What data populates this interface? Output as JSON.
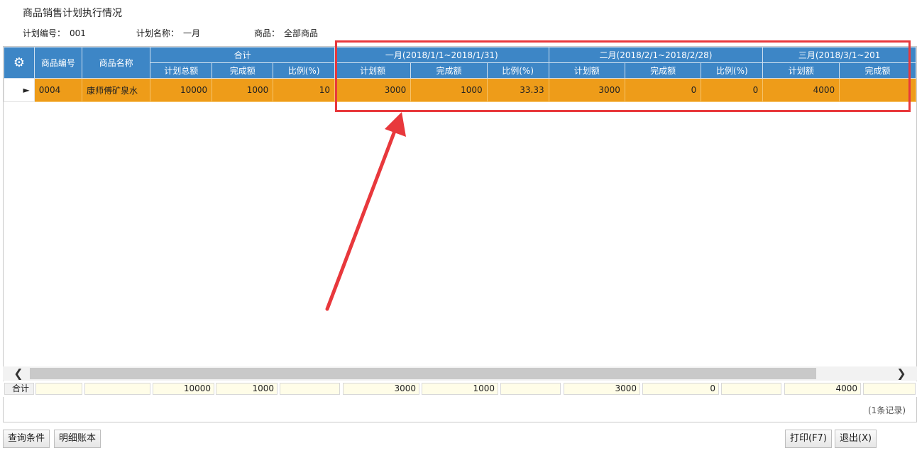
{
  "page_title": "商品销售计划执行情况",
  "meta": {
    "plan_no_label": "计划编号：",
    "plan_no": "001",
    "plan_name_label": "计划名称：",
    "plan_name": "一月",
    "goods_label": "商品：",
    "goods": "全部商品"
  },
  "grid": {
    "col_code": "商品编号",
    "col_name": "商品名称",
    "groups": [
      {
        "label": "合计",
        "sub": [
          "计划总额",
          "完成额",
          "比例(%)"
        ]
      },
      {
        "label": "一月(2018/1/1~2018/1/31)",
        "sub": [
          "计划额",
          "完成额",
          "比例(%)"
        ]
      },
      {
        "label": "二月(2018/2/1~2018/2/28)",
        "sub": [
          "计划额",
          "完成额",
          "比例(%)"
        ]
      },
      {
        "label": "三月(2018/3/1~201",
        "sub": [
          "计划额",
          "完成额"
        ]
      }
    ],
    "row": {
      "indicator": "►",
      "code": "0004",
      "name": "康师傅矿泉水",
      "cells": [
        "10000",
        "1000",
        "10",
        "3000",
        "1000",
        "33.33",
        "3000",
        "0",
        "0",
        "4000",
        ""
      ]
    }
  },
  "footer": {
    "label": "合计",
    "cells": [
      "",
      "",
      "10000",
      "1000",
      "",
      "3000",
      "1000",
      "",
      "3000",
      "0",
      "",
      "4000",
      ""
    ]
  },
  "records": "(1条记录)",
  "buttons": {
    "query": "查询条件",
    "detail": "明细账本",
    "print": "打印(F7)",
    "exit": "退出(X)"
  },
  "icons": {
    "settings": "gear-icon",
    "scroll_left": "chevron-left-icon",
    "scroll_right": "chevron-right-icon"
  },
  "colors": {
    "header": "#3d86c6",
    "row": "#ee9c19",
    "annotation": "#e8383c"
  }
}
